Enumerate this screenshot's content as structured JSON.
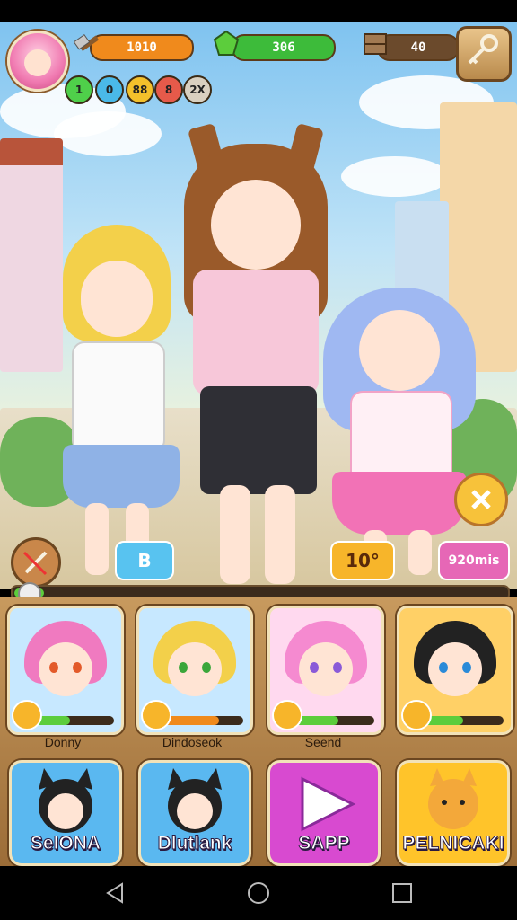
{
  "hud": {
    "resources": [
      {
        "name": "hammer",
        "value": "1010",
        "color": "#f08a1c",
        "icon": "hammer-icon"
      },
      {
        "name": "gem",
        "value": "306",
        "color": "#3dbb3a",
        "icon": "gem-icon"
      },
      {
        "name": "crate",
        "value": "40",
        "color": "#6b4a2c",
        "icon": "crate-icon"
      }
    ],
    "badges": [
      {
        "label": "1",
        "color": "#4fcf4a"
      },
      {
        "label": "0",
        "color": "#4ab9e8"
      },
      {
        "label": "88",
        "color": "#f3c02b"
      },
      {
        "label": "8",
        "color": "#e65a4a"
      },
      {
        "label": "2X",
        "color": "#d9d0c0"
      }
    ],
    "key_icon": "key-icon"
  },
  "scene": {
    "buttons": {
      "left_icon": "broom-icon",
      "blue_label": "B",
      "orange_label": "10°",
      "pink_label": "920mis",
      "close_icon": "close-icon"
    }
  },
  "progress": {
    "value": 0.06
  },
  "characters": [
    {
      "name": "Donny",
      "hair": "#f07ac0",
      "eye": "#e35a2a",
      "bar": 0.45,
      "bar_color": "#5ccd3c",
      "bg": "#c7e8ff",
      "badge_icon": "arrow-icon"
    },
    {
      "name": "Dindoseok",
      "hair": "#f3d04a",
      "eye": "#3aa63a",
      "bar": 0.7,
      "bar_color": "#f08a1c",
      "bg": "#c7e8ff",
      "badge_icon": "flower-icon"
    },
    {
      "name": "Seend",
      "hair": "#f58ad0",
      "eye": "#8a5ad8",
      "bar": 0.55,
      "bar_color": "#5ccd3c",
      "bg": "#ffd9ef",
      "badge_icon": "star-icon"
    },
    {
      "name": "",
      "hair": "#222222",
      "eye": "#2a8ad8",
      "bar": 0.5,
      "bar_color": "#5ccd3c",
      "bg": "#ffd066",
      "badge_icon": "wrench-icon"
    }
  ],
  "tiles": [
    {
      "label": "SeIONA",
      "bg": "#5ab8f0",
      "icon": "cat-girl-icon"
    },
    {
      "label": "Dlutlank",
      "bg": "#5ab8f0",
      "icon": "cat-girl-icon"
    },
    {
      "label": "SAPP",
      "bg": "#d84ad0",
      "icon": "play-icon"
    },
    {
      "label": "PELNICAKI",
      "bg": "#ffc42a",
      "icon": "dog-icon"
    }
  ],
  "nav": [
    "back-icon",
    "home-icon",
    "recents-icon"
  ]
}
